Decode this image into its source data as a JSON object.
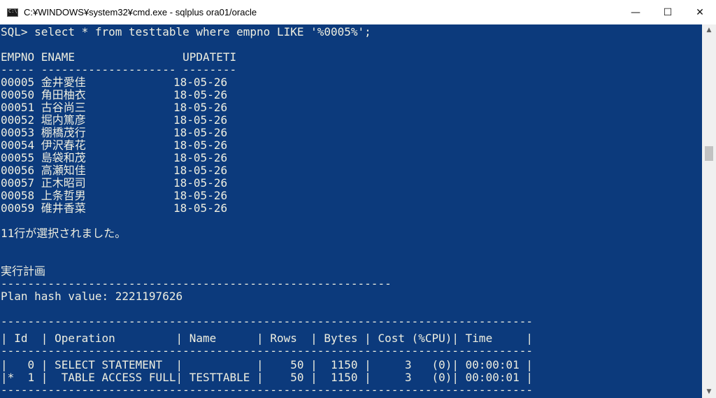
{
  "window": {
    "title": "C:¥WINDOWS¥system32¥cmd.exe - sqlplus  ora01/oracle",
    "minimize": "—",
    "maximize": "☐",
    "close": "✕"
  },
  "console": {
    "lines": [
      "SQL> select * from testtable where empno LIKE '%0005%';",
      "",
      "EMPNO ENAME                UPDATETI",
      "----- -------------------- --------",
      "00005 金井愛佳             18-05-26",
      "00050 角田柚衣             18-05-26",
      "00051 古谷尚三             18-05-26",
      "00052 堀内篤彦             18-05-26",
      "00053 棚橋茂行             18-05-26",
      "00054 伊沢春花             18-05-26",
      "00055 島袋和茂             18-05-26",
      "00056 高瀬知佳             18-05-26",
      "00057 正木昭司             18-05-26",
      "00058 上条哲男             18-05-26",
      "00059 碓井香菜             18-05-26",
      "",
      "11行が選択されました。",
      "",
      "",
      "実行計画",
      "----------------------------------------------------------",
      "Plan hash value: 2221197626",
      "",
      "-------------------------------------------------------------------------------",
      "| Id  | Operation         | Name      | Rows  | Bytes | Cost (%CPU)| Time     |",
      "-------------------------------------------------------------------------------",
      "|   0 | SELECT STATEMENT  |           |    50 |  1150 |     3   (0)| 00:00:01 |",
      "|*  1 |  TABLE ACCESS FULL| TESTTABLE |    50 |  1150 |     3   (0)| 00:00:01 |",
      "-------------------------------------------------------------------------------"
    ]
  },
  "colors": {
    "console_bg": "#0c3a7c",
    "console_fg": "#eeeee0"
  },
  "icons": {
    "app": "cmd-icon",
    "scroll_up": "arrow-up-icon",
    "scroll_down": "arrow-down-icon"
  }
}
